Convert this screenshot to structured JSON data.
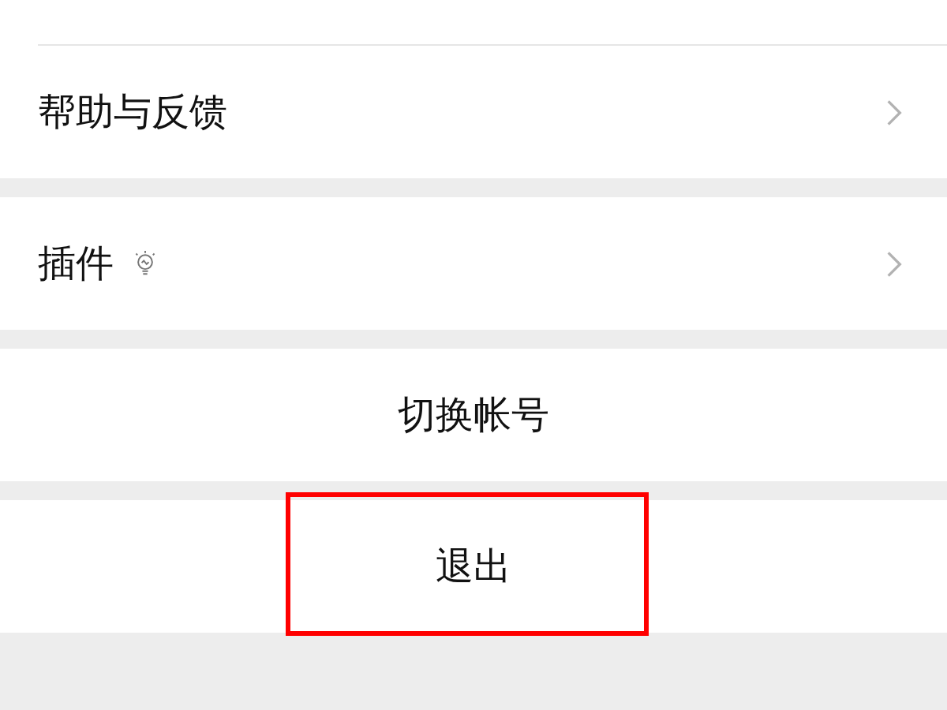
{
  "menu_groups": [
    {
      "items": [
        {
          "label": "帮助与反馈",
          "has_icon": false
        }
      ]
    },
    {
      "items": [
        {
          "label": "插件",
          "has_icon": true
        }
      ]
    }
  ],
  "actions": [
    {
      "label": "切换帐号",
      "highlighted": false
    },
    {
      "label": "退出",
      "highlighted": true
    }
  ]
}
